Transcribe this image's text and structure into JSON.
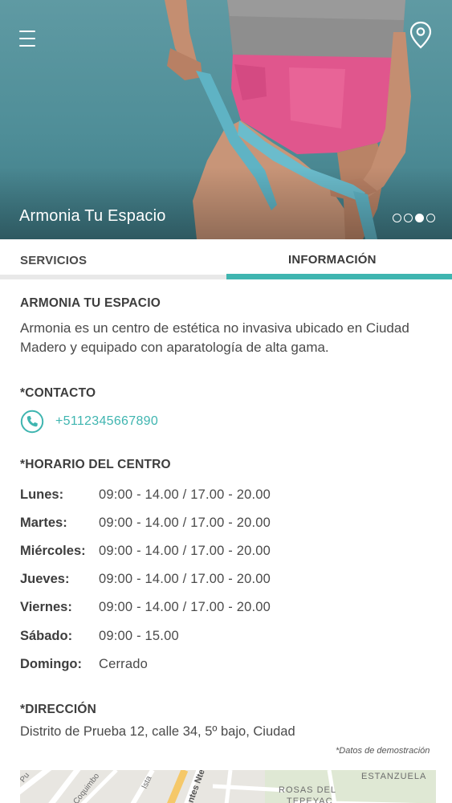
{
  "header": {
    "title": "Armonia Tu Espacio",
    "slides": 4,
    "active_slide": 3
  },
  "tabs": [
    {
      "label": "SERVICIOS",
      "active": false
    },
    {
      "label": "INFORMACIÓN",
      "active": true
    }
  ],
  "info": {
    "name_heading": "ARMONIA TU ESPACIO",
    "description": "Armonia es un centro de estética no invasiva ubicado en Ciudad Madero y equipado con aparatología de alta gama.",
    "contact_heading": "*CONTACTO",
    "phone": "+5112345667890",
    "schedule_heading": "*HORARIO DEL CENTRO",
    "schedule": [
      {
        "day": "Lunes:",
        "hours": "09:00 - 14.00  /  17.00 - 20.00"
      },
      {
        "day": "Martes:",
        "hours": "09:00 - 14.00  /  17.00 - 20.00"
      },
      {
        "day": "Miércoles:",
        "hours": "09:00 - 14.00  /  17.00 - 20.00"
      },
      {
        "day": "Jueves:",
        "hours": "09:00 - 14.00  /  17.00 - 20.00"
      },
      {
        "day": "Viernes:",
        "hours": "09:00 - 14.00  /  17.00 - 20.00"
      },
      {
        "day": "Sábado:",
        "hours": "09:00 - 15.00"
      },
      {
        "day": "Domingo:",
        "hours": "Cerrado"
      }
    ],
    "address_heading": "*DIRECCIÓN",
    "address": "Distrito de Prueba 12, calle 34, 5º bajo, Ciudad",
    "demo_note": "*Datos de demostración"
  },
  "map": {
    "labels": [
      "ESTANZUELA",
      "ROSAS DEL",
      "TEPEYAC",
      "Coquimbo",
      "Pu",
      "Ista",
      "ntes Nte"
    ]
  },
  "colors": {
    "accent": "#3fb5b0",
    "hero_bg": "#5f9aa3",
    "tab_track": "#e8e8e8"
  }
}
